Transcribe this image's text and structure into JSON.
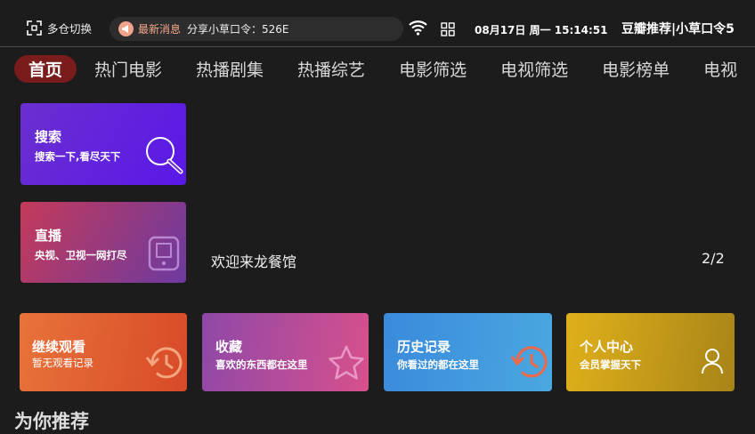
{
  "topbar": {
    "store_label": "多仓切换",
    "news_tag": "最新消息",
    "news_text": "分享小草口令：526E",
    "datetime": "08月17日 周一 15:14:51",
    "brand_text": "豆瓣推荐|小草口令5"
  },
  "nav": {
    "tabs": [
      "首页",
      "热门电影",
      "热播剧集",
      "热播综艺",
      "电影筛选",
      "电视筛选",
      "电影榜单",
      "电视"
    ]
  },
  "cards": {
    "search": {
      "title": "搜索",
      "subtitle": "搜索一下,看尽天下"
    },
    "live": {
      "title": "直播",
      "subtitle": "央视、卫视一网打尽"
    },
    "continue": {
      "title": "继续观看",
      "subtitle": "暂无观看记录"
    },
    "favorites": {
      "title": "收藏",
      "subtitle": "喜欢的东西都在这里"
    },
    "history": {
      "title": "历史记录",
      "subtitle": "你看过的都在这里"
    },
    "profile": {
      "title": "个人中心",
      "subtitle": "会员掌握天下"
    }
  },
  "banner": {
    "text": "欢迎来龙餐馆",
    "pager": "2/2"
  },
  "section": {
    "title": "为你推荐"
  },
  "icons": {
    "store": "store-switch-icon",
    "news": "megaphone-icon",
    "wifi": "wifi-icon",
    "apps": "apps-grid-icon",
    "search": "search-icon",
    "live": "tablet-icon",
    "continue": "history-icon",
    "favorites": "star-icon",
    "history": "history-icon",
    "profile": "user-icon"
  },
  "colors": {
    "background": "#1c1c1c",
    "active_tab": "#7a1c1c",
    "news_tag": "#f4a98a"
  }
}
